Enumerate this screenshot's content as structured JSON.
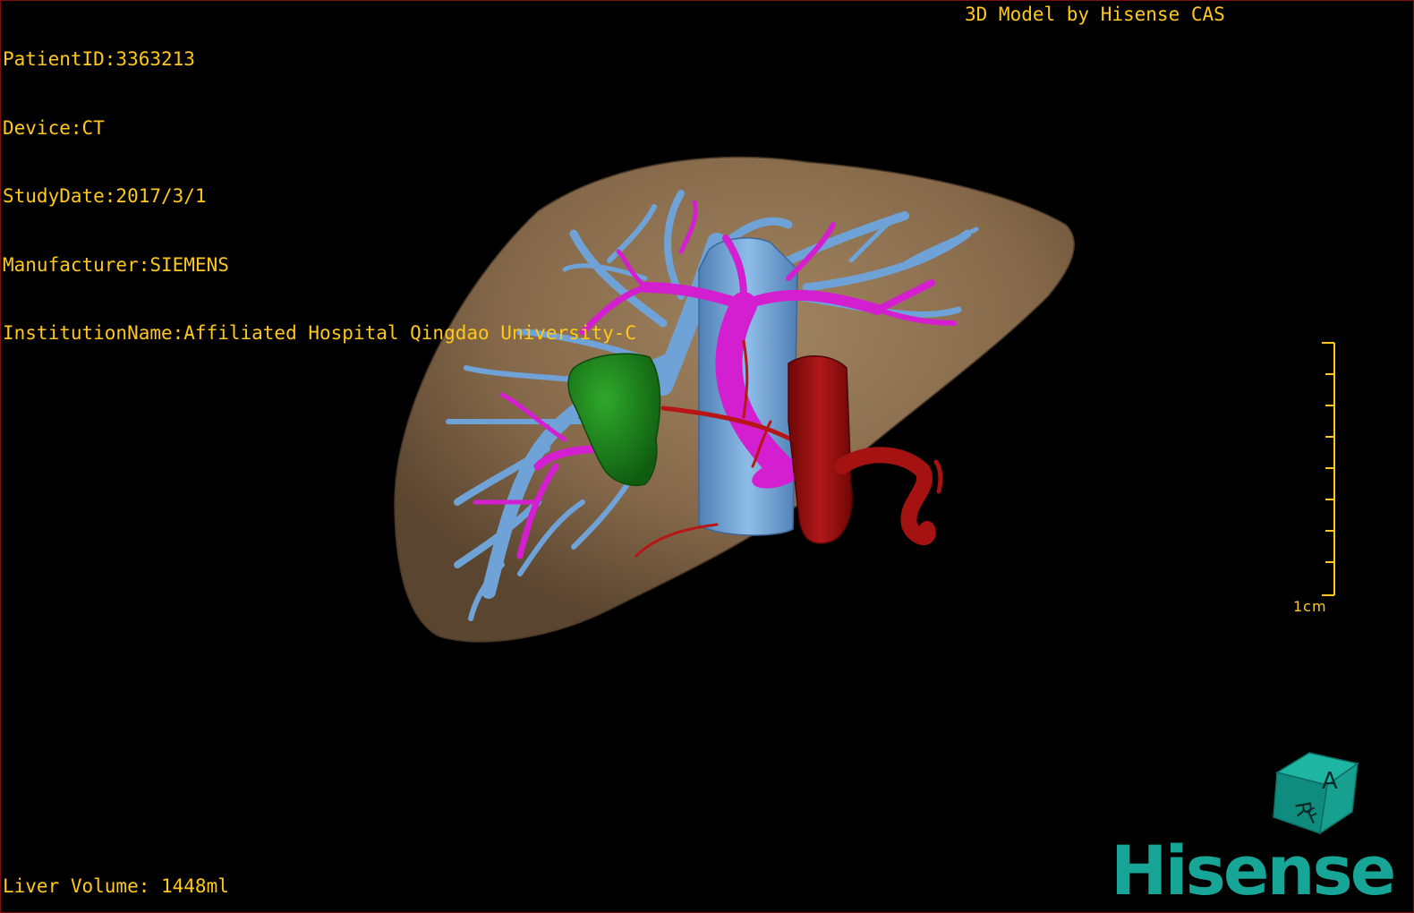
{
  "patient_info": [
    "PatientID:3363213",
    "Device:CT",
    "StudyDate:2017/3/1",
    "Manufacturer:SIEMENS",
    "InstitutionName:Affiliated Hospital Qingdao University-C"
  ],
  "caption": "3D Model by Hisense CAS",
  "liver_volume": "Liver Volume: 1448ml",
  "scale_bar": {
    "label": "1cm"
  },
  "orientation_cube": {
    "faces": [
      "A",
      "R",
      "F"
    ]
  },
  "logo": "Hisense",
  "colors": {
    "text": "#ffc81a",
    "liver": "#8a6e4e",
    "hepatic_vein": "#6fa3d8",
    "portal_vein": "#d41fd0",
    "tumor": "#1f8a1c",
    "artery": "#a41212",
    "logo": "#16a596"
  }
}
